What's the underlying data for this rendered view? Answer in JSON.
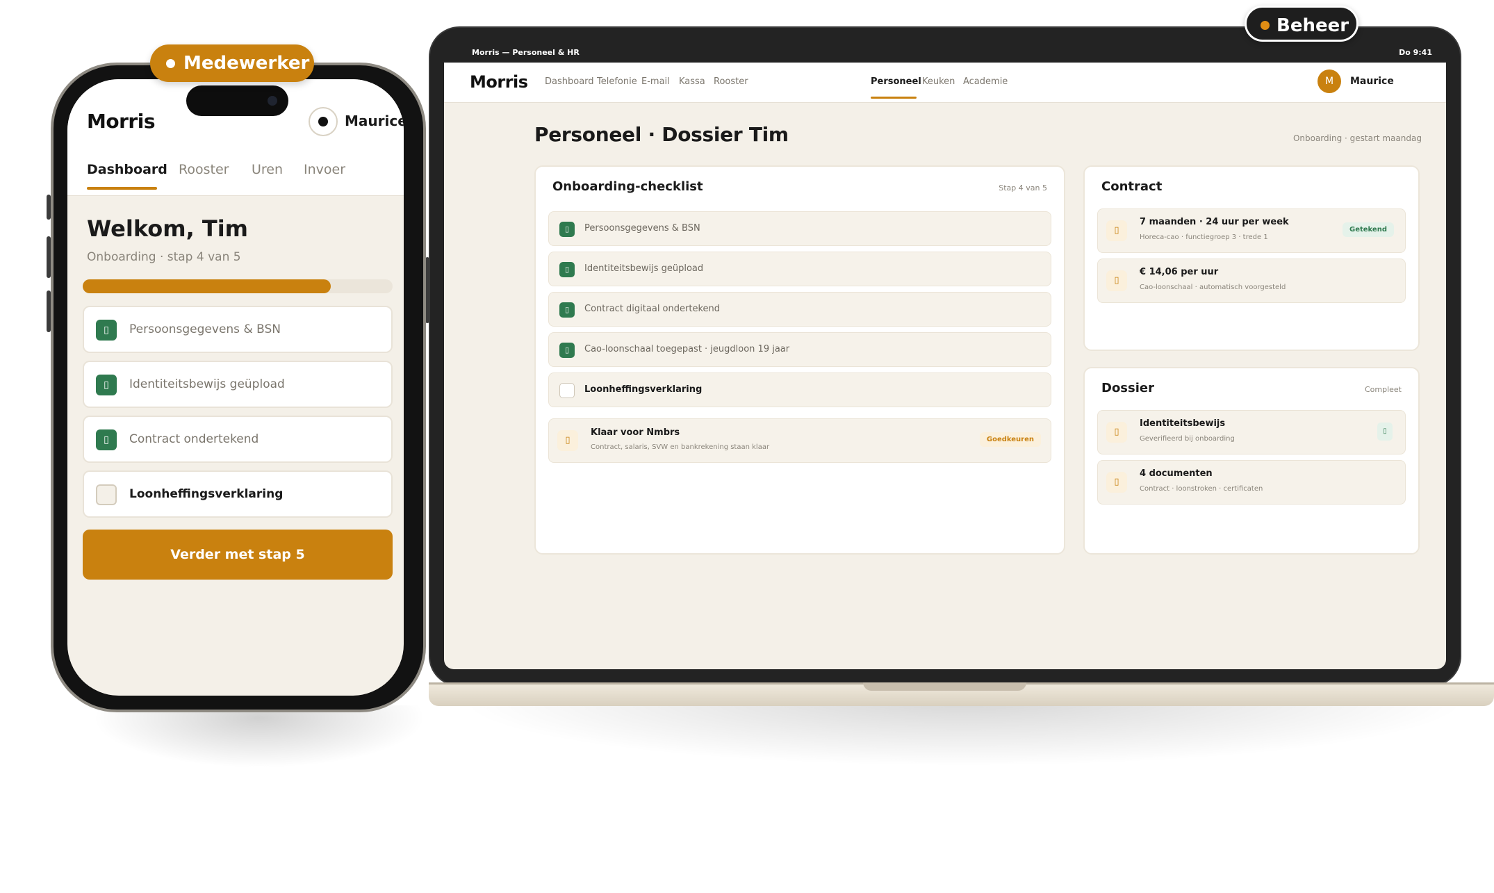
{
  "colors": {
    "accent": "#c9810f",
    "success": "#2f7a4f",
    "background": "#f4f0e8",
    "dark": "#1e1e1e"
  },
  "badges": {
    "beheer": "Beheer",
    "medewerker": "Medewerker"
  },
  "laptop": {
    "statusbar": {
      "title": "Morris — Personeel & HR",
      "time": "Do 9:41"
    },
    "brand": "Morris",
    "nav": [
      {
        "label": "Dashboard",
        "active": false
      },
      {
        "label": "Telefonie",
        "active": false
      },
      {
        "label": "E-mail",
        "active": false
      },
      {
        "label": "Kassa",
        "active": false
      },
      {
        "label": "Rooster",
        "active": false
      },
      {
        "label": "Personeel",
        "active": true
      },
      {
        "label": "Keuken",
        "active": false
      },
      {
        "label": "Academie",
        "active": false
      }
    ],
    "user": {
      "initial": "M",
      "name": "Maurice"
    },
    "page_title": "Personeel · Dossier Tim",
    "page_subtitle": "Onboarding · gestart maandag",
    "checklist": {
      "title": "Onboarding-checklist",
      "meta": "Stap 4 van 5",
      "items": [
        {
          "label": "Persoonsgegevens & BSN",
          "done": true
        },
        {
          "label": "Identiteitsbewijs geüpload",
          "done": true
        },
        {
          "label": "Contract digitaal ondertekend",
          "done": true
        },
        {
          "label": "Cao-loonschaal toegepast · jeugdloon 19 jaar",
          "done": true
        },
        {
          "label": "Loonheffingsverklaring",
          "done": false
        }
      ],
      "action": {
        "title": "Klaar voor Nmbrs",
        "subtitle": "Contract, salaris, SVW en bankrekening staan klaar",
        "button": "Goedkeuren"
      }
    },
    "contract": {
      "title": "Contract",
      "rows": [
        {
          "title": "7 maanden · 24 uur per week",
          "subtitle": "Horeca-cao · functiegroep 3 · trede 1",
          "badge": "Getekend"
        },
        {
          "title": "€ 14,06 per uur",
          "subtitle": "Cao-loonschaal · automatisch voorgesteld"
        }
      ]
    },
    "dossier": {
      "title": "Dossier",
      "meta": "Compleet",
      "rows": [
        {
          "title": "Identiteitsbewijs",
          "subtitle": "Geverifieerd bij onboarding"
        },
        {
          "title": "4 documenten",
          "subtitle": "Contract · loonstroken · certificaten"
        }
      ]
    }
  },
  "phone": {
    "brand": "Morris",
    "user": "Maurice",
    "tabs": [
      {
        "label": "Dashboard",
        "active": true
      },
      {
        "label": "Rooster",
        "active": false
      },
      {
        "label": "Uren",
        "active": false
      },
      {
        "label": "Invoer",
        "active": false
      }
    ],
    "welcome": "Welkom, Tim",
    "subtitle": "Onboarding · stap 4 van 5",
    "progress": 0.8,
    "items": [
      {
        "label": "Persoonsgegevens & BSN",
        "done": true
      },
      {
        "label": "Identiteitsbewijs geüpload",
        "done": true
      },
      {
        "label": "Contract ondertekend",
        "done": true
      },
      {
        "label": "Loonheffingsverklaring",
        "done": false
      }
    ],
    "cta": "Verder met stap 5"
  }
}
